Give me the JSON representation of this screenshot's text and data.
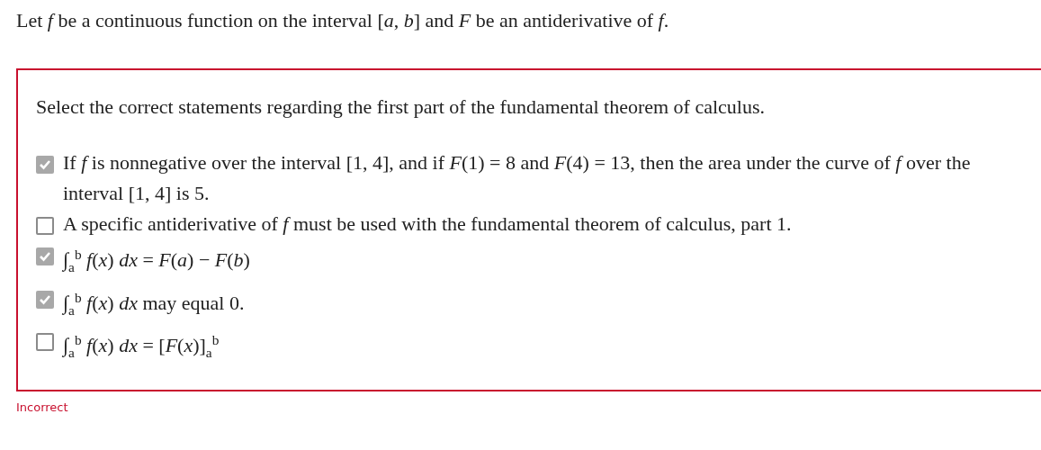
{
  "intro": "Let *f* be a continuous function on the interval [*a*, *b*] and *F* be an antiderivative of *f*.",
  "question": {
    "prompt": "Select the correct statements regarding the first part of the fundamental theorem of calculus.",
    "options": [
      {
        "text": "If *f* is nonnegative over the interval [1, 4], and if *F*(1) = 8 and *F*(4) = 13, then the area under the curve of *f* over the interval [1, 4] is 5.",
        "checked": true
      },
      {
        "text": "A specific antiderivative of *f* must be used with the fundamental theorem of calculus, part 1.",
        "checked": false
      },
      {
        "text": "∫$_{a}$$^{b}$ *f*(*x*) *dx* = *F*(*a*) − *F*(*b*)",
        "checked": true
      },
      {
        "text": "∫$_{a}$$^{b}$ *f*(*x*) *dx* may equal 0.",
        "checked": true
      },
      {
        "text": "∫$_{a}$$^{b}$ *f*(*x*) *dx* = [*F*(*x*)]$_{a}$$^{b}$",
        "checked": false
      }
    ]
  },
  "feedback": "Incorrect"
}
